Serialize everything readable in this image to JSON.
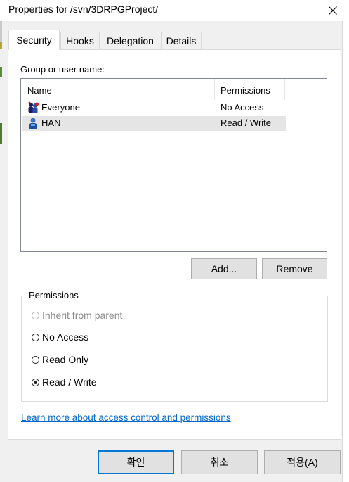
{
  "window": {
    "title": "Properties for /svn/3DRPGProject/"
  },
  "tabs": [
    {
      "label": "Security",
      "active": true
    },
    {
      "label": "Hooks",
      "active": false
    },
    {
      "label": "Delegation",
      "active": false
    },
    {
      "label": "Details",
      "active": false
    }
  ],
  "security": {
    "group_label": "Group or user name:",
    "columns": {
      "name": "Name",
      "permissions": "Permissions"
    },
    "rows": [
      {
        "name": "Everyone",
        "permission": "No Access",
        "icon": "group-icon",
        "selected": false
      },
      {
        "name": "HAN",
        "permission": "Read / Write",
        "icon": "user-icon",
        "selected": true
      }
    ],
    "add_label": "Add...",
    "remove_label": "Remove",
    "permissions_group_label": "Permissions",
    "options": [
      {
        "label": "Inherit from parent",
        "checked": false,
        "disabled": true
      },
      {
        "label": "No Access",
        "checked": false,
        "disabled": false
      },
      {
        "label": "Read Only",
        "checked": false,
        "disabled": false
      },
      {
        "label": "Read / Write",
        "checked": true,
        "disabled": false
      }
    ],
    "learn_more_link": "Learn more about access control and permissions"
  },
  "footer": {
    "ok_label": "확인",
    "cancel_label": "취소",
    "apply_label": "적용(A)"
  },
  "colors": {
    "accent": "#0078d7",
    "link": "#0066cc",
    "selected_row": "#e5e5e5"
  }
}
